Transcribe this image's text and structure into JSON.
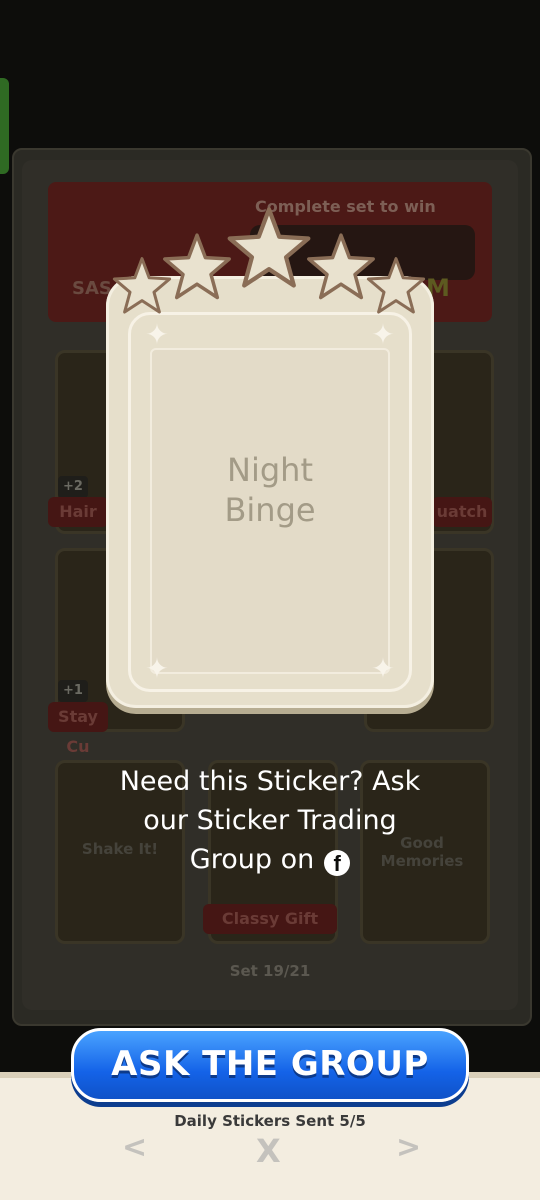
{
  "background_album": {
    "banner_text": "Complete set to win",
    "banner_left_fragment": "SAS",
    "banner_right_fragment": "M",
    "cards": [
      {
        "label": "Hair",
        "badge": "+2"
      },
      {
        "label": "uatch"
      },
      {
        "label": "Stay Cu",
        "badge": "+1"
      },
      {
        "label": "Shake It!"
      },
      {
        "label": "Classy Gift"
      },
      {
        "label": "Good Memories"
      }
    ],
    "set_progress": "Set 19/21"
  },
  "sticker": {
    "name_line1": "Night",
    "name_line2": "Binge",
    "stars": 5
  },
  "message": {
    "line1": "Need this Sticker? Ask",
    "line2": "our Sticker Trading",
    "line3": "Group on",
    "icon": "facebook-icon"
  },
  "ask_button_label": "ASK THE GROUP",
  "daily_stickers": "Daily Stickers Sent 5/5",
  "nav": {
    "prev_icon": "chevron-left-icon",
    "close_icon": "close-icon",
    "next_icon": "chevron-right-icon",
    "prev_glyph": "<",
    "close_glyph": "X",
    "next_glyph": ">"
  },
  "colors": {
    "button_blue": "#1463e8",
    "card_cream": "#e6dfcb",
    "star_cream": "#e9e2cf",
    "overlay_dark": "#0d0d0b"
  }
}
